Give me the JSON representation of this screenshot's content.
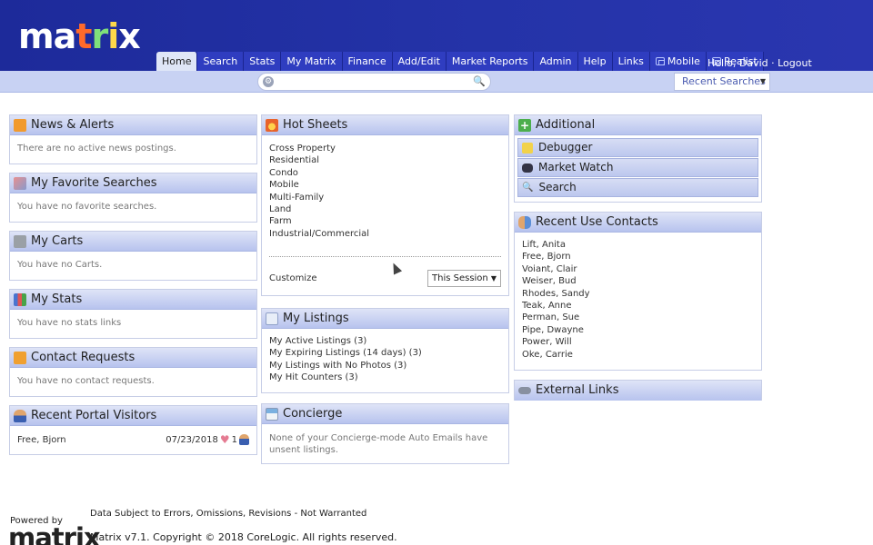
{
  "app": {
    "logo_text": "matrix"
  },
  "nav": {
    "items": [
      {
        "label": "Home",
        "active": true
      },
      {
        "label": "Search"
      },
      {
        "label": "Stats"
      },
      {
        "label": "My Matrix"
      },
      {
        "label": "Finance"
      },
      {
        "label": "Add/Edit"
      },
      {
        "label": "Market Reports"
      },
      {
        "label": "Admin"
      },
      {
        "label": "Help"
      },
      {
        "label": "Links"
      },
      {
        "label": "Mobile",
        "external": true
      },
      {
        "label": "Realist",
        "external": true
      }
    ],
    "greeting": "Hello, David · Logout"
  },
  "search": {
    "value": "",
    "recent_label": "Recent Searches"
  },
  "news": {
    "title": "News & Alerts",
    "empty": "There are no active news postings."
  },
  "favorites": {
    "title": "My Favorite Searches",
    "empty": "You have no favorite searches."
  },
  "carts": {
    "title": "My Carts",
    "empty": "You have no Carts."
  },
  "stats": {
    "title": "My Stats",
    "empty": "You have no stats links"
  },
  "contact_requests": {
    "title": "Contact Requests",
    "empty": "You have no contact requests."
  },
  "portal_visitors": {
    "title": "Recent Portal Visitors",
    "rows": [
      {
        "name": "Free, Bjorn",
        "date": "07/23/2018",
        "count": "1"
      }
    ]
  },
  "hot_sheets": {
    "title": "Hot Sheets",
    "items": [
      "Cross Property",
      "Residential",
      "Condo",
      "Mobile",
      "Multi-Family",
      "Land",
      "Farm",
      "Industrial/Commercial"
    ],
    "customize_label": "Customize",
    "period_value": "This Session"
  },
  "my_listings": {
    "title": "My Listings",
    "items": [
      "My Active Listings (3)",
      "My Expiring Listings (14 days) (3)",
      "My Listings with No Photos (3)",
      "My Hit Counters  (3)"
    ]
  },
  "concierge": {
    "title": "Concierge",
    "empty": "None of your Concierge-mode Auto Emails have unsent listings."
  },
  "additional": {
    "title": "Additional",
    "buttons": [
      "Debugger",
      "Market Watch",
      "Search"
    ]
  },
  "recent_contacts": {
    "title": "Recent Use Contacts",
    "items": [
      "Lift, Anita",
      "Free, Bjorn",
      "Voiant, Clair",
      "Weiser, Bud",
      "Rhodes, Sandy",
      "Teak, Anne",
      "Perman, Sue",
      "Pipe, Dwayne",
      "Power, Will",
      "Oke, Carrie"
    ]
  },
  "external_links": {
    "title": "External Links"
  },
  "footer": {
    "powered_by": "Powered by",
    "logo_text": "matrix",
    "disclaimer": "Data Subject to Errors, Omissions, Revisions - Not Warranted",
    "copyright": "Matrix v7.1. Copyright © 2018 CoreLogic. All rights reserved."
  },
  "colors": {
    "header_bg": "#2433a8",
    "nav_bg": "#2f3dc0",
    "panel_head": "#b7c3ee"
  }
}
